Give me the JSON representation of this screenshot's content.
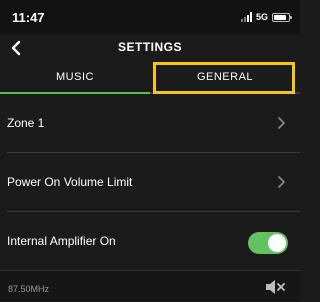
{
  "status_bar": {
    "time": "11:47",
    "network": "5G",
    "icons": [
      "signal-icon",
      "battery-icon"
    ]
  },
  "header": {
    "title": "SETTINGS",
    "back_icon": "chevron-left-icon"
  },
  "tabs": [
    {
      "label": "MUSIC",
      "selected": false
    },
    {
      "label": "GENERAL",
      "selected": true
    }
  ],
  "settings": [
    {
      "label": "Zone 1",
      "control": "chevron"
    },
    {
      "label": "Power On Volume Limit",
      "control": "chevron"
    },
    {
      "label": "Internal Amplifier On",
      "control": "toggle",
      "value": true
    }
  ],
  "player": {
    "station": "87.50MHz",
    "icon": "speaker-muted-icon"
  },
  "colors": {
    "accent_green": "#5cc04b",
    "toggle_on": "#62c262",
    "highlight": "#f5c518",
    "background": "#1b1b1b"
  }
}
